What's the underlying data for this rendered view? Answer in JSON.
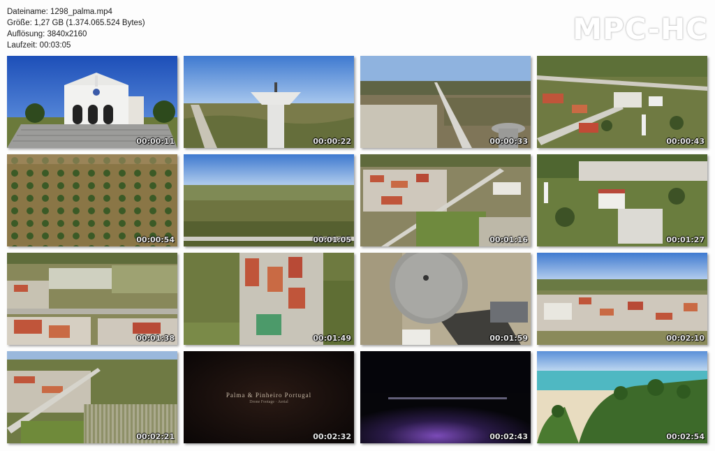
{
  "info": {
    "filename": "Dateiname: 1298_palma.mp4",
    "size": "Größe: 1,27 GB (1.374.065.524 Bytes)",
    "resolution": "Auflösung: 3840x2160",
    "duration": "Laufzeit: 00:03:05"
  },
  "brand": "MPC-HC",
  "thumbnails": [
    {
      "time": "00:00:11",
      "scene": "church"
    },
    {
      "time": "00:00:22",
      "scene": "water-tower"
    },
    {
      "time": "00:00:33",
      "scene": "road-field"
    },
    {
      "time": "00:00:43",
      "scene": "village-aerial"
    },
    {
      "time": "00:00:54",
      "scene": "orchard-rows"
    },
    {
      "time": "00:01:05",
      "scene": "landscape"
    },
    {
      "time": "00:01:16",
      "scene": "town-aerial"
    },
    {
      "time": "00:01:27",
      "scene": "church-aerial"
    },
    {
      "time": "00:01:38",
      "scene": "town-fields"
    },
    {
      "time": "00:01:49",
      "scene": "street-grid"
    },
    {
      "time": "00:01:59",
      "scene": "tower-top"
    },
    {
      "time": "00:02:10",
      "scene": "town-horizon"
    },
    {
      "time": "00:02:21",
      "scene": "farmland"
    },
    {
      "time": "00:02:32",
      "scene": "title-card",
      "title": "Palma & Pinheiro Portugal",
      "subtitle": "Drone Footage · Aerial"
    },
    {
      "time": "00:02:43",
      "scene": "dark-glow"
    },
    {
      "time": "00:02:54",
      "scene": "beach-palms"
    }
  ]
}
